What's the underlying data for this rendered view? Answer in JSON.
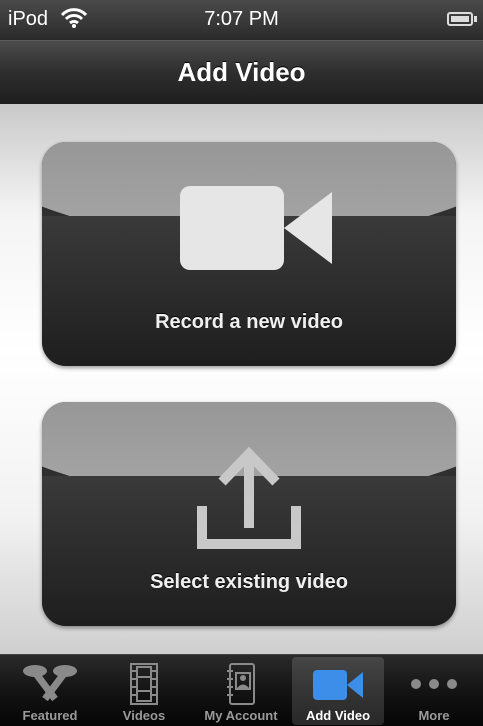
{
  "status_bar": {
    "carrier": "iPod",
    "time": "7:07 PM"
  },
  "nav": {
    "title": "Add Video"
  },
  "actions": {
    "record_label": "Record a new video",
    "select_label": "Select existing video"
  },
  "tabs": [
    {
      "label": "Featured",
      "icon": "featured-icon"
    },
    {
      "label": "Videos",
      "icon": "film-icon"
    },
    {
      "label": "My Account",
      "icon": "contact-book-icon"
    },
    {
      "label": "Add Video",
      "icon": "video-camera-icon"
    },
    {
      "label": "More",
      "icon": "more-dots-icon"
    }
  ],
  "active_tab": "Add Video",
  "colors": {
    "active_icon": "#3d8ee8",
    "inactive_icon": "#8a8a8a"
  }
}
